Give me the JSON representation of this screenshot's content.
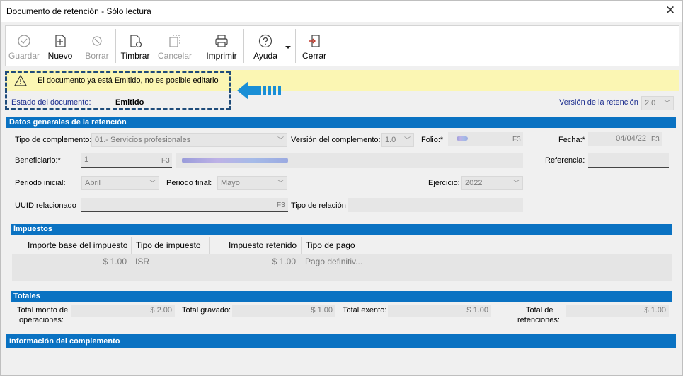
{
  "window": {
    "title": "Documento de retención - Sólo lectura",
    "close_glyph": "✕"
  },
  "toolbar": {
    "guardar": "Guardar",
    "nuevo": "Nuevo",
    "borrar": "Borrar",
    "timbrar": "Timbrar",
    "cancelar": "Cancelar",
    "imprimir": "Imprimir",
    "ayuda": "Ayuda",
    "cerrar": "Cerrar"
  },
  "alert": {
    "message": "El documento ya está Emitido, no es posible editarlo"
  },
  "estado": {
    "label": "Estado del documento:",
    "value": "Emitido"
  },
  "version_retencion": {
    "label": "Versión de la retención",
    "value": "2.0"
  },
  "datos_generales": {
    "title": "Datos generales de la retención",
    "tipo_complemento_label": "Tipo de complemento:",
    "tipo_complemento_value": "01.- Servicios profesionales",
    "version_complemento_label": "Versión del complemento:",
    "version_complemento_value": "1.0",
    "folio_label": "Folio:*",
    "folio_f3": "F3",
    "fecha_label": "Fecha:*",
    "fecha_value": "04/04/22",
    "fecha_f3": "F3",
    "beneficiario_label": "Beneficiario:*",
    "beneficiario_value": "1",
    "beneficiario_f3": "F3",
    "referencia_label": "Referencia:",
    "periodo_inicial_label": "Periodo inicial:",
    "periodo_inicial_value": "Abril",
    "periodo_final_label": "Periodo final:",
    "periodo_final_value": "Mayo",
    "ejercicio_label": "Ejercicio:",
    "ejercicio_value": "2022",
    "uuid_label": "UUID relacionado",
    "uuid_f3": "F3",
    "tipo_relacion_label": "Tipo de relación"
  },
  "impuestos": {
    "title": "Impuestos",
    "columns": [
      "Importe base del impuesto",
      "Tipo de impuesto",
      "Impuesto retenido",
      "Tipo de pago"
    ],
    "rows": [
      [
        "$ 1.00",
        "ISR",
        "$ 1.00",
        "Pago definitiv..."
      ]
    ]
  },
  "totales": {
    "title": "Totales",
    "total_operaciones_label_1": "Total monto de",
    "total_operaciones_label_2": "operaciones:",
    "total_operaciones_value": "$ 2.00",
    "total_gravado_label": "Total gravado:",
    "total_gravado_value": "$ 1.00",
    "total_exento_label": "Total exento:",
    "total_exento_value": "$ 1.00",
    "total_retenciones_label_1": "Total de",
    "total_retenciones_label_2": "retenciones:",
    "total_retenciones_value": "$ 1.00"
  },
  "complemento": {
    "title": "Información del complemento"
  },
  "icons": [
    "check-circle-icon",
    "new-document-icon",
    "delete-icon",
    "stamp-document-icon",
    "cancel-document-icon",
    "printer-icon",
    "help-icon",
    "dropdown-arrow-icon",
    "exit-door-icon",
    "warning-icon",
    "arrow-left-icon"
  ],
  "colors": {
    "section_blue": "#0a72c2",
    "alert_yellow": "#fbf6b3",
    "label_blue": "#1c2e8f",
    "dashed_border": "#1f4c7a",
    "arrow_blue": "#1a8fd6"
  }
}
